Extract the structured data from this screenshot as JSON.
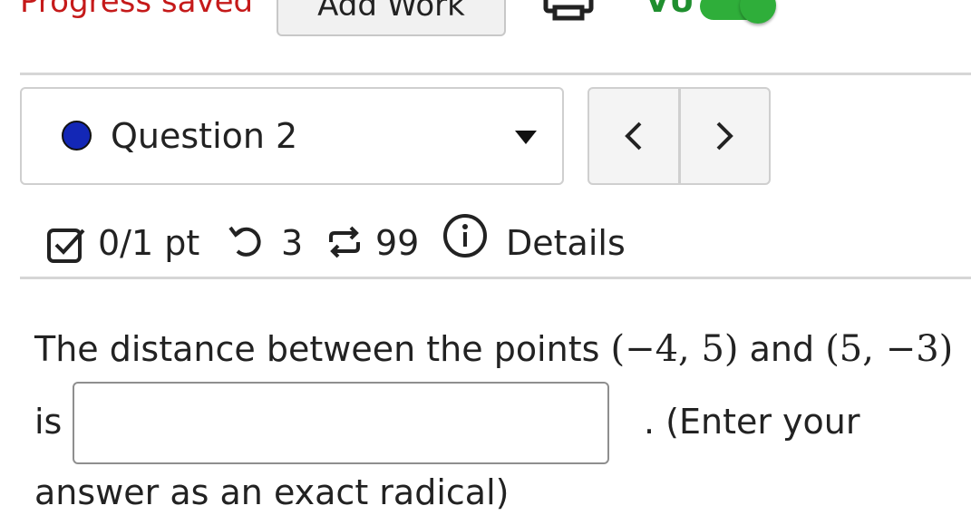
{
  "topbar": {
    "progress_status": "Progress saved",
    "add_work_label": "Add Work",
    "print_icon": "printer-icon",
    "vu_label": "VU",
    "toggle_state": "on",
    "toggle_color": "#2fae3a",
    "status_color": "#c51a1a"
  },
  "question_selector": {
    "label": "Question 2",
    "dot_color": "#1327b6",
    "caret_icon": "caret-down-icon"
  },
  "nav": {
    "prev_label": "<",
    "next_label": ">"
  },
  "info_row": {
    "points": "0/1 pt",
    "tries": "3",
    "versions": "99",
    "details_label": "Details",
    "icons": [
      "checkbox-icon",
      "undo-icon",
      "repeat-icon",
      "info-icon"
    ]
  },
  "question": {
    "text_before": "The distance between the points ",
    "point1": "(−4, 5)",
    "text_and": " and ",
    "point2": "(5, −3)",
    "is_label": "is",
    "answer_value": "",
    "after_input": ". (Enter your",
    "line3": "answer as an exact radical)"
  }
}
